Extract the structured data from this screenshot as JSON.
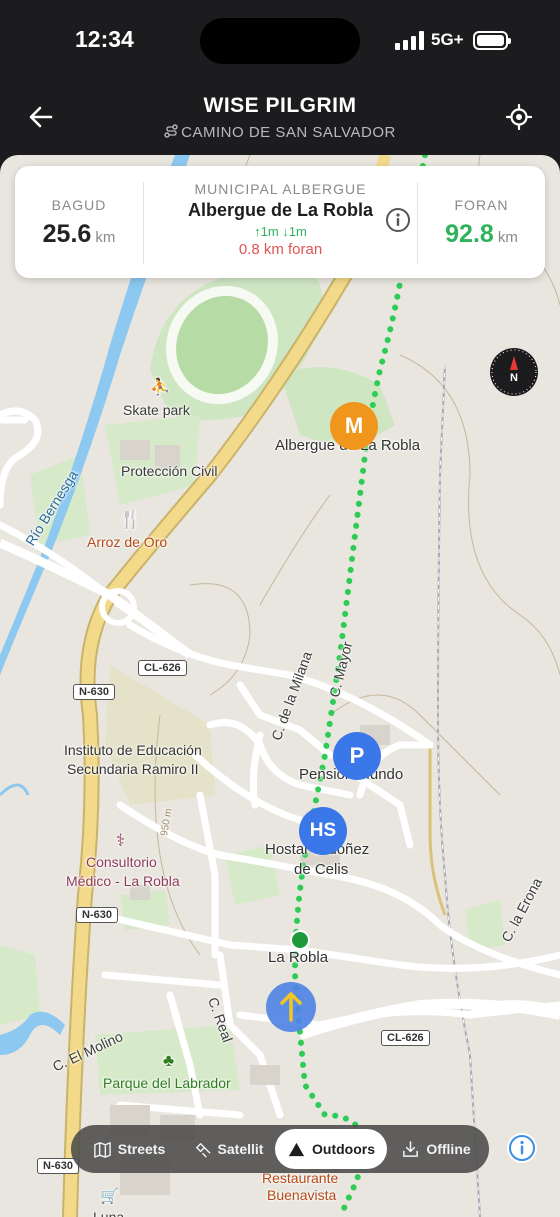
{
  "status_bar": {
    "time": "12:34",
    "network": "5G+"
  },
  "header": {
    "title": "WISE PILGRIM",
    "subtitle": "CAMINO DE SAN SALVADOR"
  },
  "info_card": {
    "behind_label": "BAGUD",
    "behind_value": "25.6",
    "behind_unit": "km",
    "albergue_type": "MUNICIPAL ALBERGUE",
    "albergue_name": "Albergue de La Robla",
    "elevation": "↑1m ↓1m",
    "distance_ahead": "0.8 km foran",
    "ahead_label": "FORAN",
    "ahead_value": "92.8",
    "ahead_unit": "km"
  },
  "map_labels": {
    "skate_park": "Skate park",
    "albergue": "Albergue de La Robla",
    "proteccion_civil": "Protección Civil",
    "arroz_de_oro": "Arroz de Oro",
    "rio_bernesga": "Río Bernesga",
    "calle_mayor": "C. Mayor",
    "calle_milana": "C. de la Milana",
    "instituto_1": "Instituto de Educación",
    "instituto_2": "Secundaria Ramiro II",
    "pension_mundo": "Pensión Mundo",
    "hostal_1": "Hostal Ordoñez",
    "hostal_2": "de Celis",
    "consultorio_1": "Consultorio",
    "consultorio_2": "Médico - La Robla",
    "contour": "950 m",
    "la_robla": "La Robla",
    "calle_real": "C. Real",
    "calle_erona": "C. la Erona",
    "calle_molino": "C. El Molino",
    "parque": "Parque del Labrador",
    "restaurante_1": "Restaurante",
    "restaurante_2": "Buenavista",
    "luna": "Luna"
  },
  "road_shields": {
    "cl626_a": "CL-626",
    "n630_a": "N-630",
    "n630_b": "N-630",
    "cl626_b": "CL-626",
    "n630_c": "N-630"
  },
  "pois": {
    "albergue_marker": "M",
    "pension_marker": "P",
    "hostal_marker": "HS"
  },
  "map_modes": {
    "streets": "Streets",
    "satellite": "Satellit",
    "outdoors": "Outdoors",
    "offline": "Offline",
    "active": "Outdoors"
  },
  "colors": {
    "route": "#2ecc55",
    "albergue_marker": "#f0961c",
    "lodging_marker": "#3a77e8",
    "user_marker": "#5b8ee6",
    "ahead_value": "#2fb35a",
    "distance_ahead": "#e05555"
  }
}
